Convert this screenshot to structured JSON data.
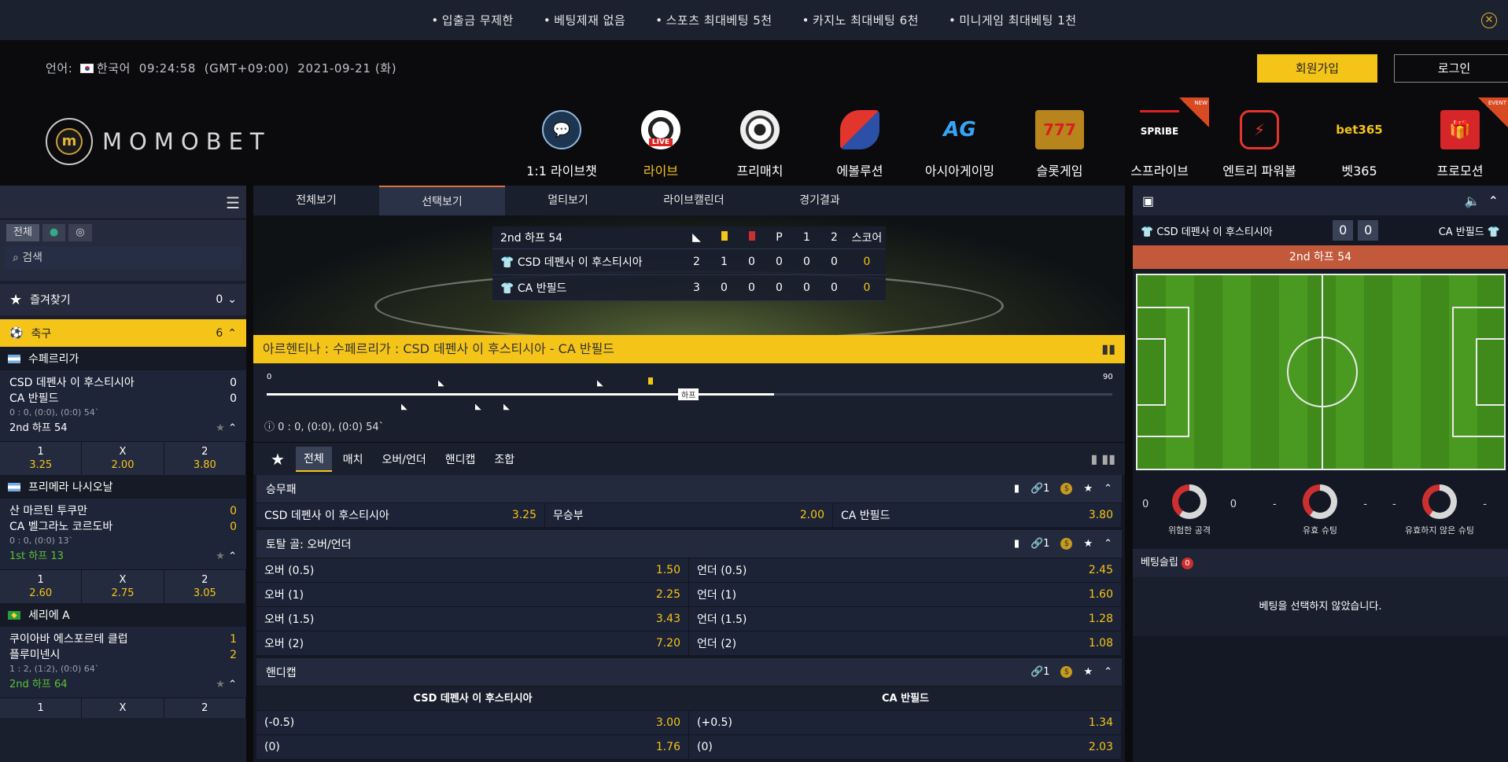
{
  "notice": {
    "items": [
      "입출금 무제한",
      "베팅제재 없음",
      "스포츠 최대베팅 5천",
      "카지노 최대베팅 6천",
      "미니게임 최대베팅 1천"
    ]
  },
  "info": {
    "lang_label": "언어:",
    "lang_value": "한국어",
    "time": "09:24:58",
    "timezone": "(GMT+09:00)",
    "date": "2021-09-21 (화)"
  },
  "auth": {
    "signup": "회원가입",
    "login": "로그인"
  },
  "logo": {
    "text": "MOMOBET",
    "mark": "m"
  },
  "nav": [
    {
      "label": "1:1 라이브챗",
      "icon": "chat-headset-icon"
    },
    {
      "label": "라이브",
      "icon": "live-ball-icon"
    },
    {
      "label": "프리매치",
      "icon": "soccer-ball-icon"
    },
    {
      "label": "에볼루션",
      "icon": "evolution-icon"
    },
    {
      "label": "아시아게이밍",
      "icon": "ag-icon",
      "glyph": "AG"
    },
    {
      "label": "슬롯게임",
      "icon": "slot-777-icon",
      "glyph": "777"
    },
    {
      "label": "스프라이브",
      "icon": "spribe-icon",
      "glyph": "SPRIBE",
      "ribbon": "NEW"
    },
    {
      "label": "엔트리 파워볼",
      "icon": "entry-powerball-icon"
    },
    {
      "label": "벳365",
      "icon": "bet365-icon",
      "glyph": "bet365"
    },
    {
      "label": "프로모션",
      "icon": "gift-icon",
      "ribbon": "EVENT"
    }
  ],
  "sidebar": {
    "filters": [
      "전체"
    ],
    "search_placeholder": "검색",
    "favorites": {
      "label": "즐겨찾기",
      "count": "0"
    },
    "sport": {
      "label": "축구",
      "count": "6"
    },
    "leagues": [
      {
        "name": "수페르리가",
        "flag": "argentina",
        "match": {
          "home": "CSD 데펜사 이 후스티시아",
          "away": "CA 반필드",
          "home_score": "0",
          "away_score": "0",
          "score_detail": "0 : 0, (0:0), (0:0) 54`",
          "status": "2nd 하프 54",
          "odds": [
            {
              "k": "1",
              "v": "3.25"
            },
            {
              "k": "X",
              "v": "2.00"
            },
            {
              "k": "2",
              "v": "3.80"
            }
          ]
        }
      },
      {
        "name": "프리메라 나시오날",
        "flag": "argentina",
        "match": {
          "home": "산 마르틴 투쿠만",
          "away": "CA 벨그라노 코르도바",
          "home_score": "0",
          "away_score": "0",
          "score_detail": "0 : 0, (0:0) 13`",
          "status": "1st 하프 13",
          "odds": [
            {
              "k": "1",
              "v": "2.60"
            },
            {
              "k": "X",
              "v": "2.75"
            },
            {
              "k": "2",
              "v": "3.05"
            }
          ]
        }
      },
      {
        "name": "세리에 A",
        "flag": "brazil",
        "match": {
          "home": "쿠이아바 에스포르테 클럽",
          "away": "플루미넨시",
          "home_score": "1",
          "away_score": "2",
          "score_detail": "1 : 2, (1:2), (0:0) 64`",
          "status": "2nd 하프 64",
          "odds": [
            {
              "k": "1",
              "v": ""
            },
            {
              "k": "X",
              "v": ""
            },
            {
              "k": "2",
              "v": ""
            }
          ]
        }
      }
    ]
  },
  "center": {
    "tabs": [
      "전체보기",
      "선택보기",
      "멀티보기",
      "라이브캘린더",
      "경기결과"
    ],
    "active_tab": 1,
    "scoreboard": {
      "period": "2nd 하프 54",
      "cols": [
        "P",
        "1",
        "2",
        "스코어"
      ],
      "teams": [
        {
          "name": "CSD 데펜사 이 후스티시아",
          "vals": [
            "2",
            "1",
            "0",
            "0",
            "0",
            "0",
            "0"
          ]
        },
        {
          "name": "CA 반필드",
          "vals": [
            "3",
            "0",
            "0",
            "0",
            "0",
            "0",
            "0"
          ]
        }
      ]
    },
    "title": "아르헨티나 : 수페르리가 : CSD 데펜사 이 후스티시아 - CA 반필드",
    "timeline": {
      "start": "0",
      "end": "90",
      "half": "하프",
      "info": "0 : 0, (0:0), (0:0) 54`",
      "progress": 0.6
    },
    "bet_tabs": [
      "전체",
      "매치",
      "오버/언더",
      "핸디캡",
      "조합"
    ],
    "markets": [
      {
        "title": "승무패",
        "links": "1",
        "rows": [
          [
            {
              "l": "CSD 데펜사 이 후스티시아",
              "v": "3.25"
            },
            {
              "l": "무승부",
              "v": "2.00"
            },
            {
              "l": "CA 반필드",
              "v": "3.80"
            }
          ]
        ]
      },
      {
        "title": "토탈 골: 오버/언더",
        "links": "1",
        "rows": [
          [
            {
              "l": "오버 (0.5)",
              "v": "1.50"
            },
            {
              "l": "언더 (0.5)",
              "v": "2.45"
            }
          ],
          [
            {
              "l": "오버 (1)",
              "v": "2.25"
            },
            {
              "l": "언더 (1)",
              "v": "1.60"
            }
          ],
          [
            {
              "l": "오버 (1.5)",
              "v": "3.43"
            },
            {
              "l": "언더 (1.5)",
              "v": "1.28"
            }
          ],
          [
            {
              "l": "오버 (2)",
              "v": "7.20"
            },
            {
              "l": "언더 (2)",
              "v": "1.08"
            }
          ]
        ]
      },
      {
        "title": "핸디캡",
        "links": "1",
        "headers": [
          "CSD 데펜사 이 후스티시아",
          "CA 반필드"
        ],
        "rows": [
          [
            {
              "l": "(-0.5)",
              "v": "3.00"
            },
            {
              "l": "(+0.5)",
              "v": "1.34"
            }
          ],
          [
            {
              "l": "(0)",
              "v": "1.76"
            },
            {
              "l": "(0)",
              "v": "2.03"
            }
          ]
        ]
      }
    ]
  },
  "right": {
    "home": "CSD 데펜사 이 후스티시아",
    "away": "CA 반필드",
    "home_score": "0",
    "away_score": "0",
    "period": "2nd 하프 54",
    "stats": [
      {
        "label": "위험한 공격",
        "home": "0",
        "away": "0"
      },
      {
        "label": "유효 슈팅",
        "home": "-",
        "away": "-"
      },
      {
        "label": "유효하지 않은 슈팅",
        "home": "-",
        "away": "-"
      }
    ],
    "betslip": {
      "label": "베팅슬립",
      "count": "0",
      "empty": "베팅을 선택하지 않았습니다."
    }
  },
  "colors": {
    "accent": "#f5c418",
    "header_bg": "#1c2130",
    "card_red": "#cc2f2f"
  }
}
